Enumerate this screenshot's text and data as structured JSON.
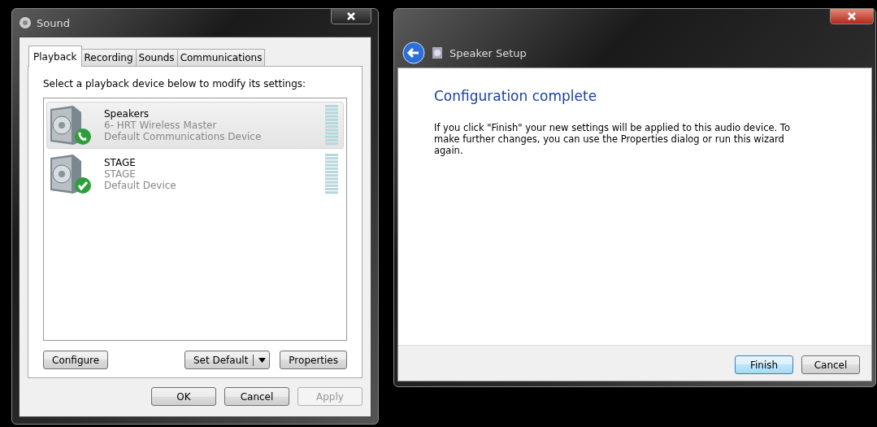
{
  "sound_window": {
    "title": "Sound",
    "tabs": [
      {
        "label": "Playback",
        "selected": true
      },
      {
        "label": "Recording",
        "selected": false
      },
      {
        "label": "Sounds",
        "selected": false
      },
      {
        "label": "Communications",
        "selected": false
      }
    ],
    "instruction": "Select a playback device below to modify its settings:",
    "devices": [
      {
        "name": "Speakers",
        "description": "6- HRT Wireless Master",
        "status": "Default Communications Device",
        "kind": "phone",
        "selected": true
      },
      {
        "name": "STAGE",
        "description": "STAGE",
        "status": "Default Device",
        "kind": "check",
        "selected": false
      }
    ],
    "panel_buttons": {
      "configure": "Configure",
      "set_default": "Set Default",
      "properties": "Properties"
    },
    "buttons": [
      {
        "label": "OK",
        "disabled": false
      },
      {
        "label": "Cancel",
        "disabled": false
      },
      {
        "label": "Apply",
        "disabled": true
      }
    ]
  },
  "setup_window": {
    "title": "Speaker Setup",
    "heading": "Configuration complete",
    "body": "If you click \"Finish\" your new settings will be applied to this audio device.  To make further changes, you can use the Properties dialog or run this wizard again.",
    "buttons": [
      {
        "label": "Finish",
        "default": true
      },
      {
        "label": "Cancel",
        "default": false
      }
    ]
  }
}
